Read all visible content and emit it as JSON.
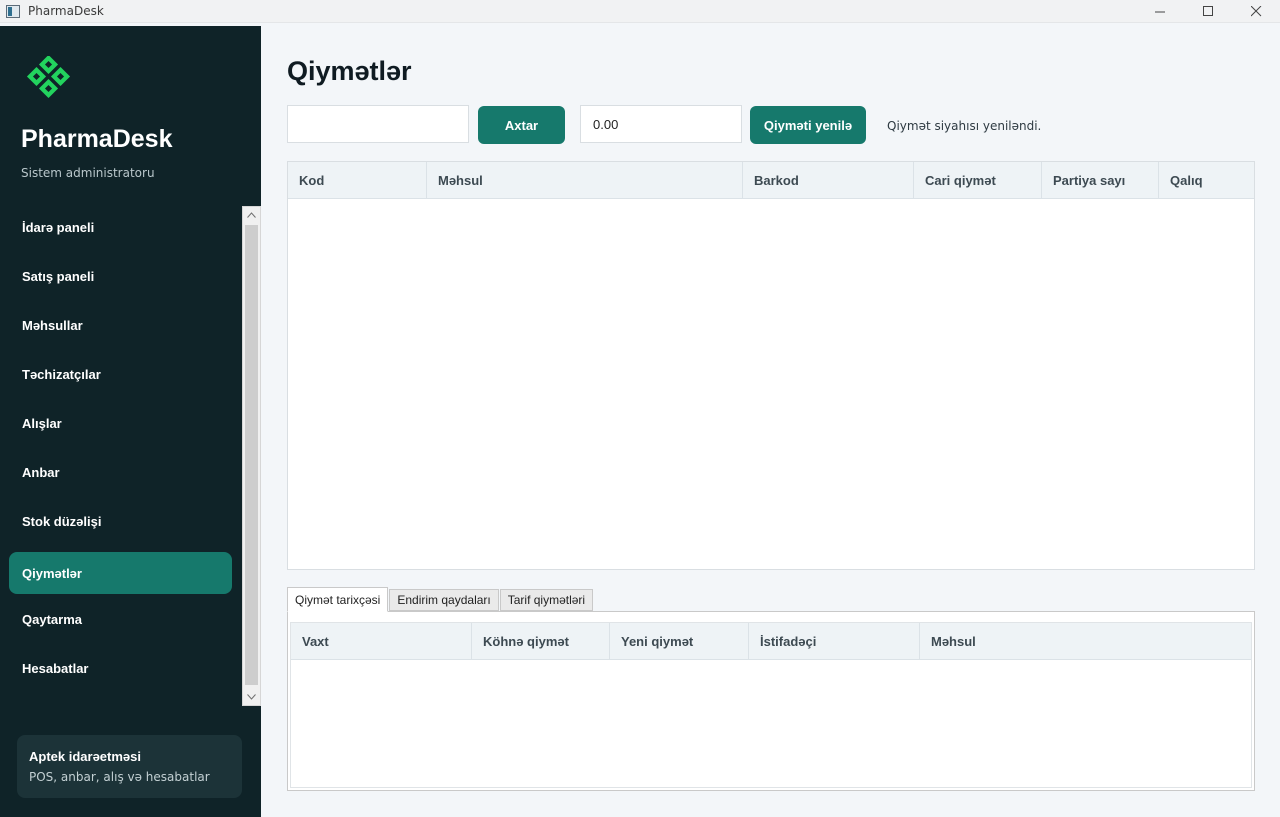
{
  "window": {
    "title": "PharmaDesk",
    "controls": [
      "minimize",
      "maximize",
      "close"
    ]
  },
  "sidebar": {
    "brand": "PharmaDesk",
    "role": "Sistem administratoru",
    "logo_color": "#22d35e",
    "items": [
      {
        "label": "İdarə paneli"
      },
      {
        "label": "Satış paneli"
      },
      {
        "label": "Məhsullar"
      },
      {
        "label": "Təchizatçılar"
      },
      {
        "label": "Alışlar"
      },
      {
        "label": "Anbar"
      },
      {
        "label": "Stok düzəlişi"
      },
      {
        "label": "Qiymətlər",
        "active": true
      },
      {
        "label": "Qaytarma"
      },
      {
        "label": "Hesabatlar"
      }
    ],
    "card": {
      "title": "Aptek idarəetməsi",
      "subtitle": "POS, anbar, alış və hesabatlar"
    }
  },
  "main": {
    "title": "Qiymətlər",
    "search": {
      "value": "",
      "button": "Axtar"
    },
    "price": {
      "value": "0.00",
      "button": "Qiyməti yenilə"
    },
    "status": "Qiymət siyahısı yeniləndi.",
    "products_table": {
      "columns": [
        "Kod",
        "Məhsul",
        "Barkod",
        "Cari qiymət",
        "Partiya sayı",
        "Qalıq"
      ],
      "rows": []
    },
    "tabs": [
      "Qiymət tarixçəsi",
      "Endirim qaydaları",
      "Tarif qiymətləri"
    ],
    "active_tab": "Qiymət tarixçəsi",
    "history_table": {
      "columns": [
        "Vaxt",
        "Köhnə qiymət",
        "Yeni qiymət",
        "İstifadəçi",
        "Məhsul"
      ],
      "rows": []
    }
  },
  "colors": {
    "accent": "#16796c",
    "sidebar_bg": "#0f2328",
    "page_bg": "#f3f6f9"
  }
}
